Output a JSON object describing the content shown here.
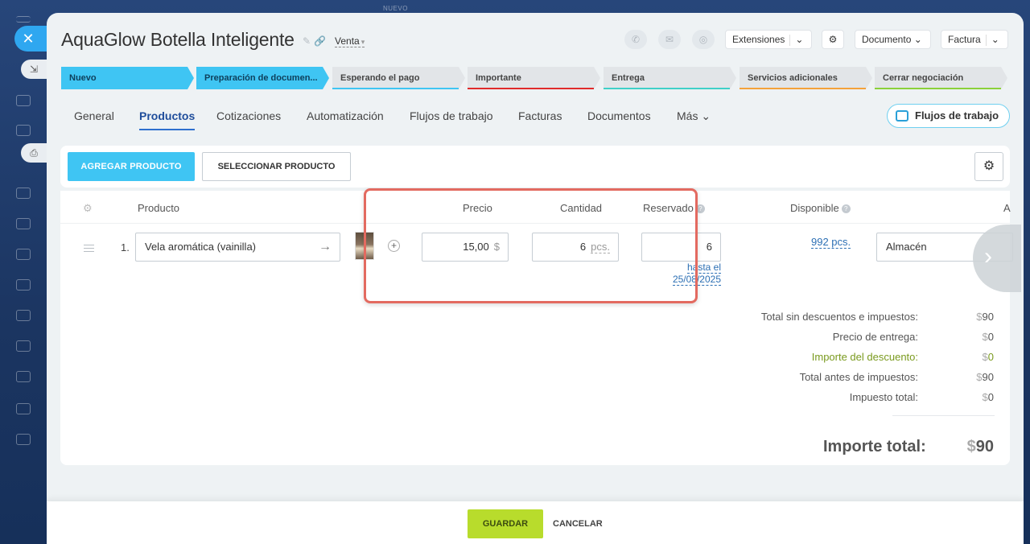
{
  "topbar": {
    "new_label": "NUEVO"
  },
  "deal": {
    "title": "AquaGlow Botella Inteligente",
    "type": "Venta"
  },
  "header_buttons": {
    "extensions": "Extensiones",
    "document": "Documento",
    "invoice": "Factura"
  },
  "stages": [
    {
      "label": "Nuevo",
      "color": "#3fc5f3",
      "active": true
    },
    {
      "label": "Preparación de documen...",
      "color": "#3fc5f3",
      "active": true
    },
    {
      "label": "Esperando el pago",
      "color": "#3fc5f3",
      "active": false
    },
    {
      "label": "Importante",
      "color": "#e02b2b",
      "active": false
    },
    {
      "label": "Entrega",
      "color": "#3fd0c8",
      "active": false
    },
    {
      "label": "Servicios adicionales",
      "color": "#f4a23a",
      "active": false
    },
    {
      "label": "Cerrar negociación",
      "color": "#8bd13a",
      "active": false
    }
  ],
  "tabs": [
    "General",
    "Productos",
    "Cotizaciones",
    "Automatización",
    "Flujos de trabajo",
    "Facturas",
    "Documentos",
    "Más"
  ],
  "active_tab": "Productos",
  "workflows_button": "Flujos de trabajo",
  "toolbar": {
    "add_product": "AGREGAR PRODUCTO",
    "select_product": "SELECCIONAR PRODUCTO"
  },
  "table": {
    "headers": {
      "product": "Producto",
      "price": "Precio",
      "quantity": "Cantidad",
      "reserved": "Reservado",
      "available": "Disponible",
      "extra": "A"
    },
    "rows": [
      {
        "num": "1.",
        "product": "Vela aromática (vainilla)",
        "price": "15,00",
        "currency": "$",
        "quantity": "6",
        "unit": "pcs.",
        "reserved": "6",
        "reserved_until_1": "hasta el",
        "reserved_until_2": "25/08/2025",
        "available": "992 pcs.",
        "warehouse": "Almacén"
      }
    ]
  },
  "totals": {
    "rows": [
      {
        "label": "Total sin descuentos e impuestos:",
        "currency": "$",
        "value": "90"
      },
      {
        "label": "Precio de entrega:",
        "currency": "$",
        "value": "0"
      },
      {
        "label": "Importe del descuento:",
        "currency": "$",
        "value": "0"
      },
      {
        "label": "Total antes de impuestos:",
        "currency": "$",
        "value": "90"
      },
      {
        "label": "Impuesto total:",
        "currency": "$",
        "value": "0"
      }
    ],
    "grand_label": "Importe total:",
    "grand_currency": "$",
    "grand_value": "90"
  },
  "footer": {
    "save": "GUARDAR",
    "cancel": "CANCELAR"
  }
}
